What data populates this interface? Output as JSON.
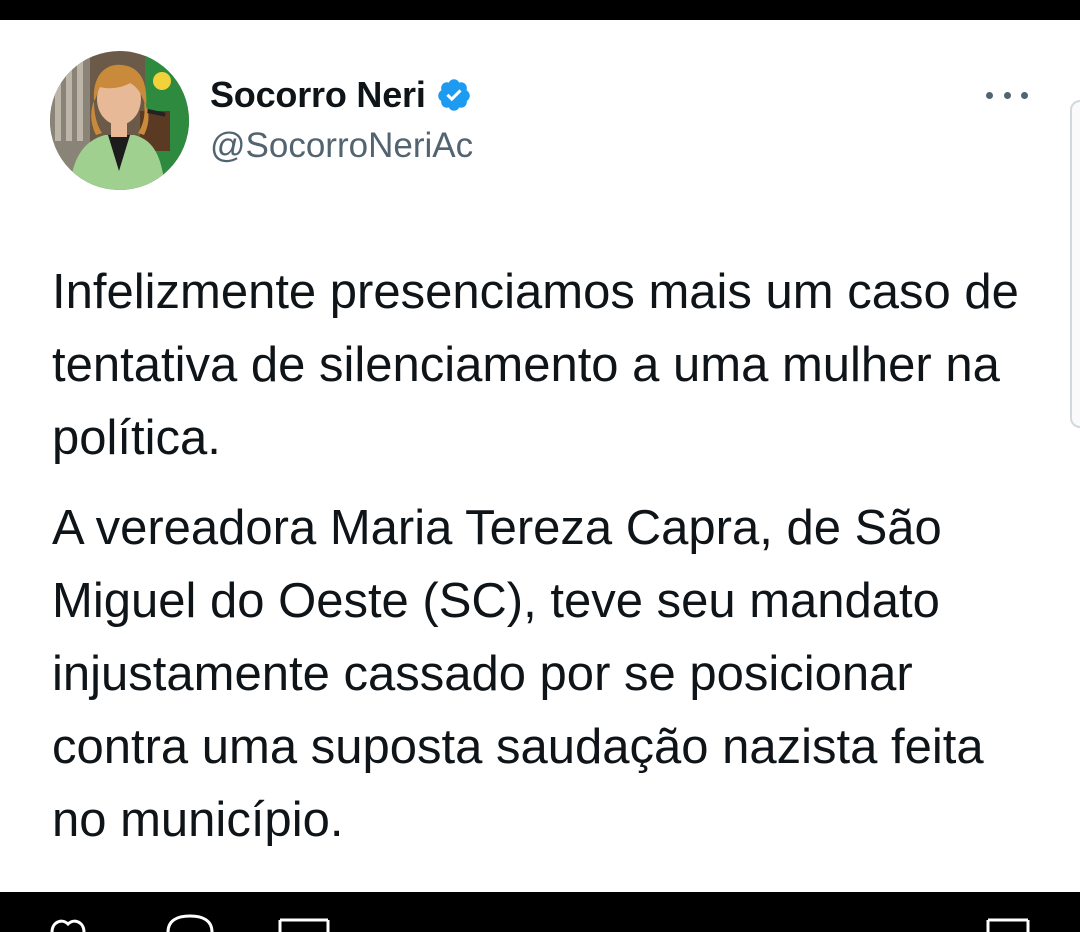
{
  "author": {
    "display_name": "Socorro Neri",
    "handle": "@SocorroNeriAc",
    "verified": true
  },
  "icons": {
    "avatar": "profile-photo",
    "verified": "verified-badge-icon",
    "more": "more-options-icon",
    "actions": [
      "heart-icon",
      "reply-icon",
      "retweet-icon",
      "share-icon"
    ]
  },
  "tweet": {
    "paragraphs": [
      "Infelizmente presenciamos mais um caso de tentativa de silenciamento a uma mulher na política.",
      "A vereadora Maria Tereza Capra, de São Miguel do Oeste (SC), teve seu mandato injustamente cassado por se posicionar contra uma suposta saudação nazista feita no município."
    ]
  },
  "colors": {
    "verified_blue": "#1d9bf0",
    "text_primary": "#0f1419",
    "text_secondary": "#536471"
  }
}
